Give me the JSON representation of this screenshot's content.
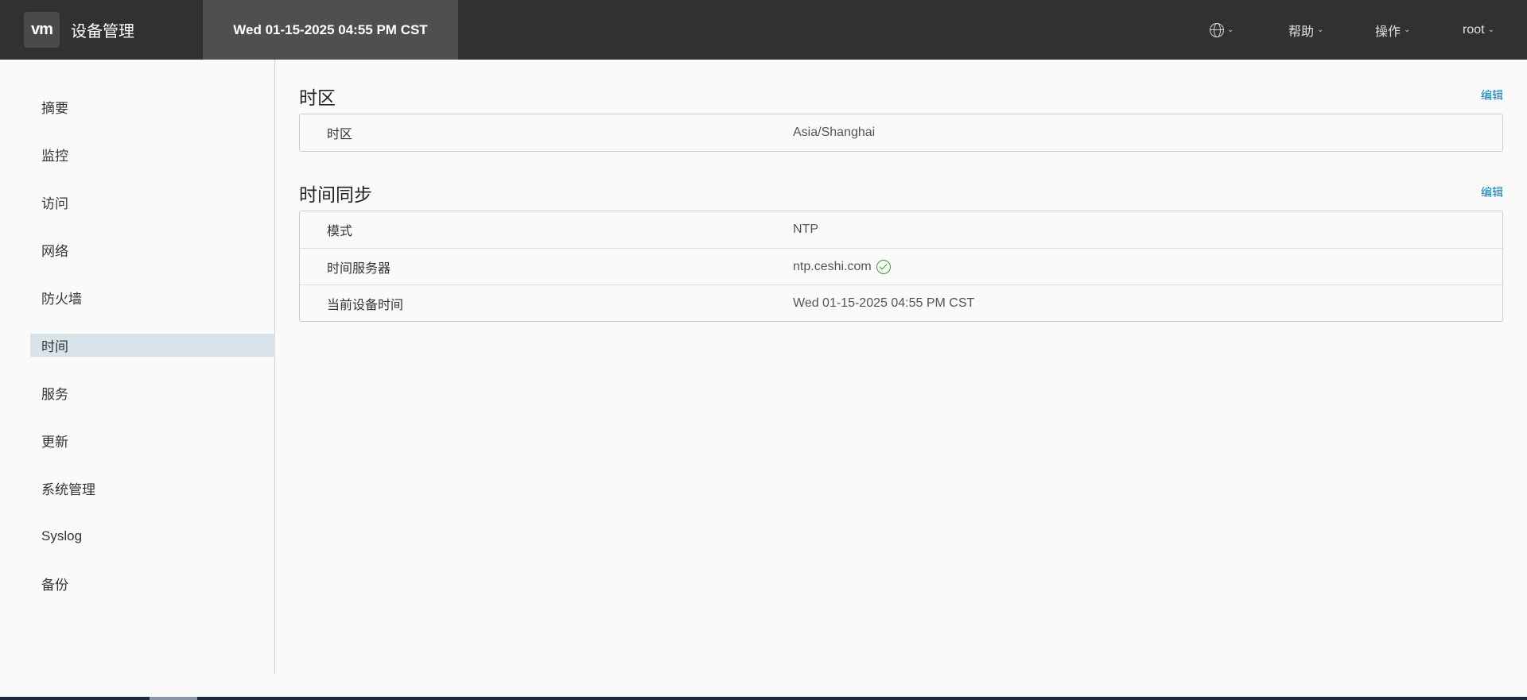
{
  "header": {
    "logo_text": "vm",
    "app_title": "设备管理",
    "clock": "Wed 01-15-2025 04:55 PM CST",
    "menus": {
      "help": "帮助",
      "actions": "操作",
      "user": "root"
    },
    "chevron": "⌄"
  },
  "sidebar": {
    "items": [
      {
        "label": "摘要"
      },
      {
        "label": "监控"
      },
      {
        "label": "访问"
      },
      {
        "label": "网络"
      },
      {
        "label": "防火墙"
      },
      {
        "label": "时间"
      },
      {
        "label": "服务"
      },
      {
        "label": "更新"
      },
      {
        "label": "系统管理"
      },
      {
        "label": "Syslog"
      },
      {
        "label": "备份"
      }
    ],
    "active_index": 5
  },
  "timezone": {
    "title": "时区",
    "edit": "编辑",
    "rows": [
      {
        "key": "时区",
        "value": "Asia/Shanghai"
      }
    ]
  },
  "sync": {
    "title": "时间同步",
    "edit": "编辑",
    "rows": [
      {
        "key": "模式",
        "value": "NTP"
      },
      {
        "key": "时间服务器",
        "value": "ntp.ceshi.com",
        "status_icon": "check-circle-icon"
      },
      {
        "key": "当前设备时间",
        "value": "Wed 01-15-2025 04:55 PM CST"
      }
    ]
  },
  "colors": {
    "header_bg": "#313131",
    "link": "#0079b8",
    "active_nav": "#d9e3ea",
    "ok": "#3c9a2e"
  }
}
